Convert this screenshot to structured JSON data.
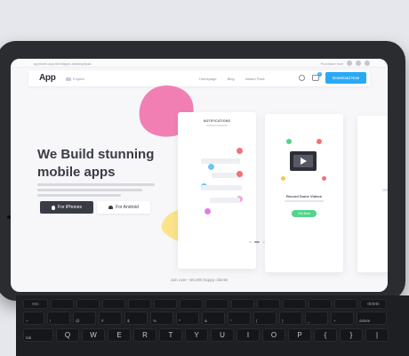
{
  "browser": {
    "url": "apptown.app.html/apps-landing/ipad",
    "right_text": "Purchase now"
  },
  "navbar": {
    "logo": "App",
    "language": "English",
    "links": [
      "Homepage",
      "Blog",
      "Instant Pack"
    ],
    "cart_count": "2",
    "cta": "Download Now"
  },
  "hero": {
    "title": "We Build stunning mobile apps",
    "buttons": {
      "ios": "For iPhones",
      "android": "For Android"
    }
  },
  "cards": {
    "notifications": {
      "title": "NOTIFICATIONS"
    },
    "movie": {
      "title": "Record Some Videos",
      "button": "Get Now"
    }
  },
  "footer": {
    "text": "Join over +25,000 happy clients!"
  },
  "keyboard": {
    "fn_row": [
      "esc",
      "",
      "",
      "",
      "",
      "",
      "",
      "",
      "",
      "",
      "",
      "",
      "",
      "delete"
    ],
    "number_row": [
      "~",
      "!",
      "@",
      "#",
      "$",
      "%",
      "^",
      "&",
      "*",
      "(",
      ")",
      "_",
      "+",
      "delete"
    ],
    "top_row": [
      "tab",
      "Q",
      "W",
      "E",
      "R",
      "T",
      "Y",
      "U",
      "I",
      "O",
      "P",
      "{",
      "}",
      "|"
    ]
  },
  "colors": {
    "accent_blue": "#2aa9f5",
    "pink_blob": "#f27fb4",
    "yellow_blob": "#fbe38a",
    "green_button": "#55d38a"
  }
}
